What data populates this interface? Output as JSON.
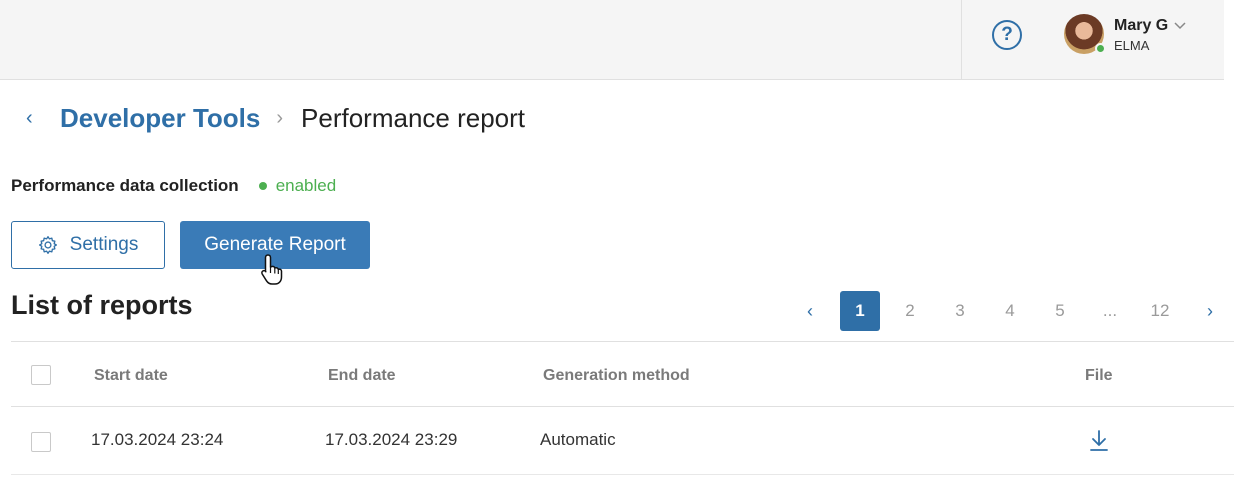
{
  "header": {
    "help_label": "?",
    "user": {
      "name": "Mary G",
      "org": "ELMA"
    }
  },
  "breadcrumb": {
    "back_label": "‹",
    "parent": "Developer Tools",
    "separator": "›",
    "current": "Performance report"
  },
  "collection": {
    "label": "Performance data collection",
    "status": "enabled",
    "status_color": "#4caf50"
  },
  "actions": {
    "settings_label": "Settings",
    "generate_label": "Generate Report"
  },
  "list": {
    "title": "List of reports"
  },
  "pagination": {
    "prev": "‹",
    "pages": [
      "1",
      "2",
      "3",
      "4",
      "5",
      "...",
      "12"
    ],
    "active": "1",
    "next": "›"
  },
  "table": {
    "columns": [
      "Start date",
      "End date",
      "Generation method",
      "File"
    ],
    "rows": [
      {
        "start": "17.03.2024 23:24",
        "end": "17.03.2024 23:29",
        "method": "Automatic",
        "file_icon": "download-icon"
      }
    ]
  },
  "colors": {
    "accent": "#2f6fa7",
    "button": "#3a7bb7",
    "success": "#4caf50"
  }
}
